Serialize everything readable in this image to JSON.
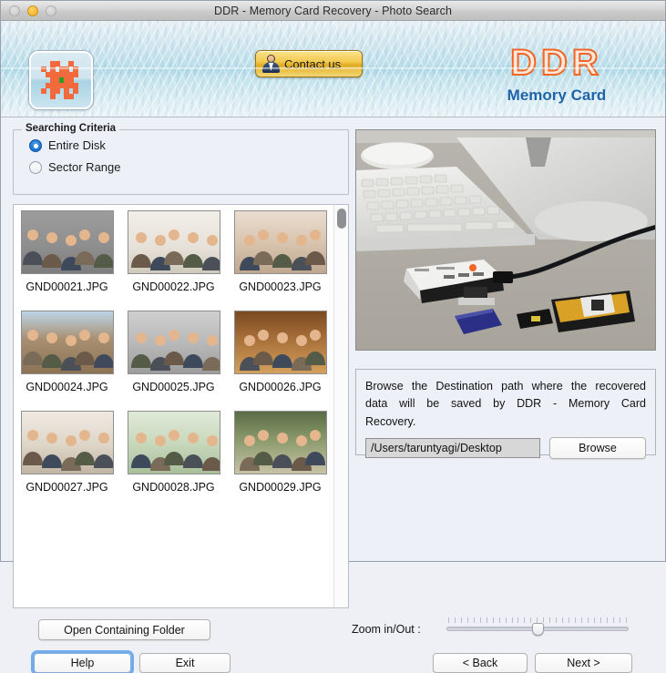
{
  "window": {
    "title": "DDR - Memory Card Recovery - Photo Search",
    "traffic": {
      "close": "close-button",
      "minimize": "minimize-button",
      "zoom": "zoom-button"
    }
  },
  "banner": {
    "app_icon": "checkerboard-flower-icon",
    "contact_button": {
      "label": "Contact us",
      "icon": "person-icon",
      "color": "#f0c34a"
    },
    "brand": {
      "primary": "DDR",
      "secondary": "Memory Card",
      "primary_color": "#f26522",
      "secondary_color": "#1c63a8"
    }
  },
  "searching_criteria": {
    "legend": "Searching Criteria",
    "options": [
      {
        "label": "Entire Disk",
        "selected": true
      },
      {
        "label": "Sector Range",
        "selected": false
      }
    ],
    "selected_color": "#1b74d8"
  },
  "thumbnails": {
    "rows": [
      [
        {
          "filename": "GND00021.JPG"
        },
        {
          "filename": "GND00022.JPG"
        },
        {
          "filename": "GND00023.JPG"
        }
      ],
      [
        {
          "filename": "GND00024.JPG"
        },
        {
          "filename": "GND00025.JPG"
        },
        {
          "filename": "GND00026.JPG"
        }
      ],
      [
        {
          "filename": "GND00027.JPG"
        },
        {
          "filename": "GND00028.JPG"
        },
        {
          "filename": "GND00029.JPG"
        }
      ]
    ]
  },
  "preview": {
    "alt": "memory-card-reader-photo"
  },
  "destination": {
    "description": "Browse the Destination path where the recovered data will be saved by DDR - Memory Card Recovery.",
    "path_value": "/Users/taruntyagi/Desktop",
    "browse_label": "Browse"
  },
  "footer": {
    "open_containing_folder": "Open Containing Folder",
    "help": "Help",
    "exit": "Exit",
    "back": "< Back",
    "next": "Next >",
    "zoom_label": "Zoom in/Out :",
    "zoom_percent": 50
  }
}
